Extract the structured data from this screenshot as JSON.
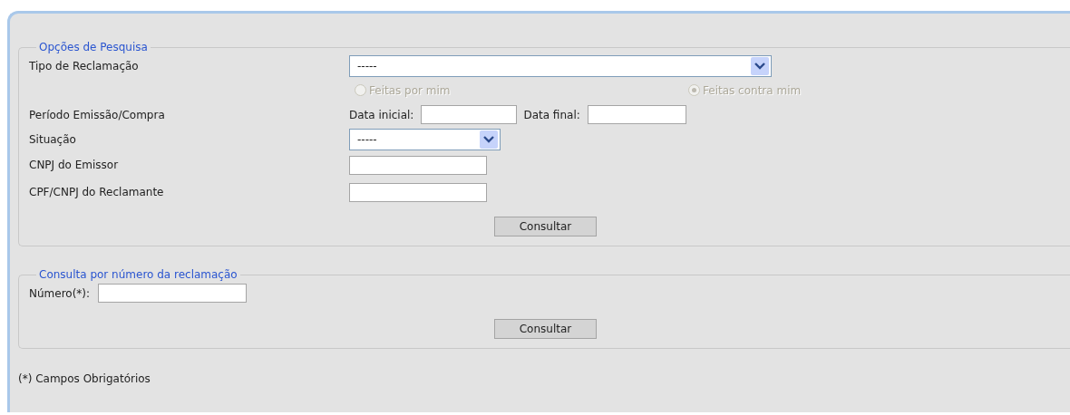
{
  "sections": [
    {
      "kind": "search",
      "legend": "Opções de Pesquisa",
      "rows": [
        {
          "kind": "select",
          "label": "Tipo de Reclamação",
          "value": "-----"
        },
        {
          "kind": "radios",
          "options": [
            {
              "label": "Feitas por mim",
              "selected": false,
              "disabled": true
            },
            {
              "label": "Feitas contra mim",
              "selected": true,
              "disabled": true
            }
          ]
        },
        {
          "kind": "dates",
          "label": "Período Emissão/Compra",
          "fields": [
            {
              "label": "Data inicial:"
            },
            {
              "label": "Data final:"
            }
          ]
        },
        {
          "kind": "select",
          "label": "Situação",
          "value": "-----"
        },
        {
          "kind": "text",
          "label": "CNPJ do Emissor"
        },
        {
          "kind": "text",
          "label": "CPF/CNPJ do Reclamante"
        }
      ],
      "button": "Consultar"
    },
    {
      "kind": "number",
      "legend": "Consulta por número da reclamação",
      "rows": [
        {
          "kind": "inline",
          "label": "Número(*):"
        }
      ],
      "button": "Consultar"
    }
  ],
  "footnote": "(*) Campos Obrigatórios"
}
